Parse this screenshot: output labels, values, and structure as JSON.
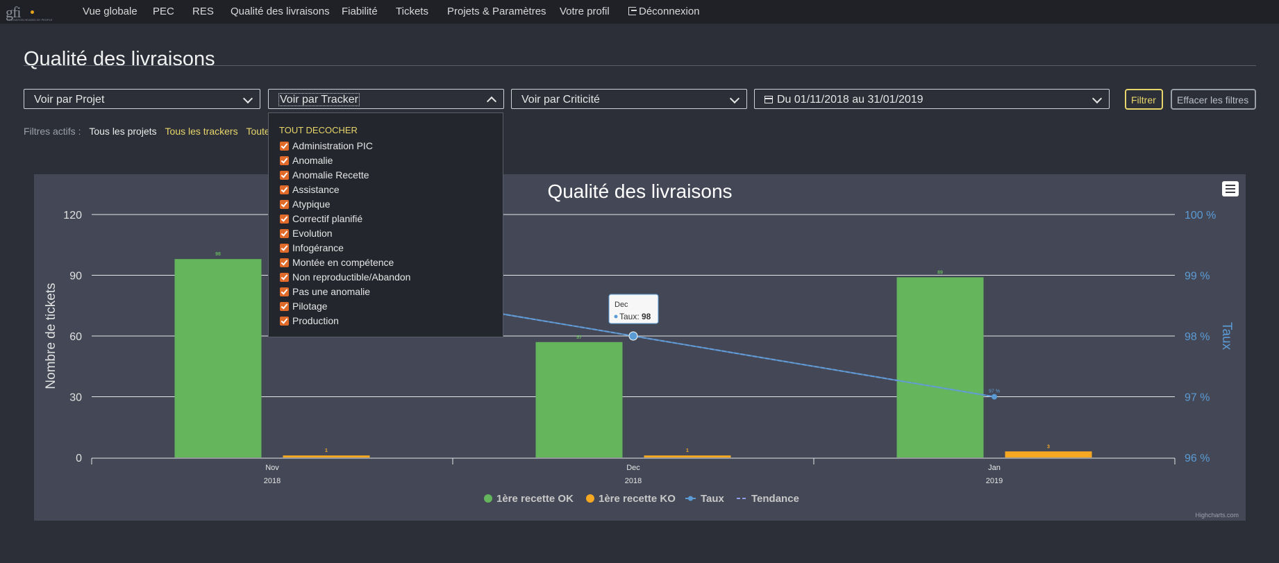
{
  "nav": {
    "logo_text": "gfi",
    "logo_tagline": "INNOVATION HEADED BY PEOPLE",
    "items": [
      "Vue globale",
      "PEC",
      "RES",
      "Qualité des livraisons",
      "Fiabilité",
      "Tickets",
      "Projets & Paramètres",
      "Votre profil"
    ],
    "logout": "Déconnexion"
  },
  "page": {
    "title": "Qualité des livraisons"
  },
  "filters": {
    "projet": "Voir par Projet",
    "tracker": "Voir par Tracker",
    "criticite": "Voir par Criticité",
    "date": "Du 01/11/2018 au 31/01/2019",
    "filter_button": "Filtrer",
    "clear_button": "Effacer les filtres"
  },
  "active_filters": {
    "label": "Filtres actifs :",
    "values": [
      "Tous les projets",
      "Tous les trackers",
      "Toutes"
    ]
  },
  "tracker_dropdown": {
    "uncheck_all": "TOUT DECOCHER",
    "items": [
      "Administration PIC",
      "Anomalie",
      "Anomalie Recette",
      "Assistance",
      "Atypique",
      "Correctif planifié",
      "Evolution",
      "Infogérance",
      "Montée en compétence",
      "Non reproductible/Abandon",
      "Pas une anomalie",
      "Pilotage",
      "Production"
    ]
  },
  "colors": {
    "ok": "#64b55c",
    "ko": "#f7a822",
    "taux": "#5b9bd5",
    "tendance": "#8f9ee8",
    "axis_right": "#5b9bd5"
  },
  "chart_data": {
    "type": "bar",
    "title": "Qualité des livraisons",
    "categories": [
      "Nov",
      "Dec",
      "Jan"
    ],
    "category_years": [
      "2018",
      "2018",
      "2019"
    ],
    "ylabel": "Nombre de tickets",
    "ylim": [
      0,
      120
    ],
    "yticks": [
      0,
      30,
      60,
      90,
      120
    ],
    "y2label": "Taux",
    "y2lim": [
      96,
      100
    ],
    "y2ticks": [
      "96 %",
      "97 %",
      "98 %",
      "99 %",
      "100 %"
    ],
    "series": [
      {
        "name": "1ère recette OK",
        "type": "bar",
        "values": [
          98,
          57,
          89
        ],
        "labels": [
          "98",
          "57",
          "89"
        ]
      },
      {
        "name": "1ère recette KO",
        "type": "bar",
        "values": [
          1,
          1,
          3
        ],
        "labels": [
          "1",
          "1",
          "3"
        ]
      },
      {
        "name": "Taux",
        "type": "line",
        "values": [
          99,
          98,
          97
        ],
        "labels": [
          "",
          "",
          "97 %"
        ]
      },
      {
        "name": "Tendance",
        "type": "dashed-line",
        "values": [
          99,
          98,
          97
        ]
      }
    ],
    "tooltip": {
      "category": "Dec",
      "series": "Taux",
      "value": "98"
    },
    "grid": true,
    "legend": "bottom-center",
    "credits": "Highcharts.com"
  }
}
